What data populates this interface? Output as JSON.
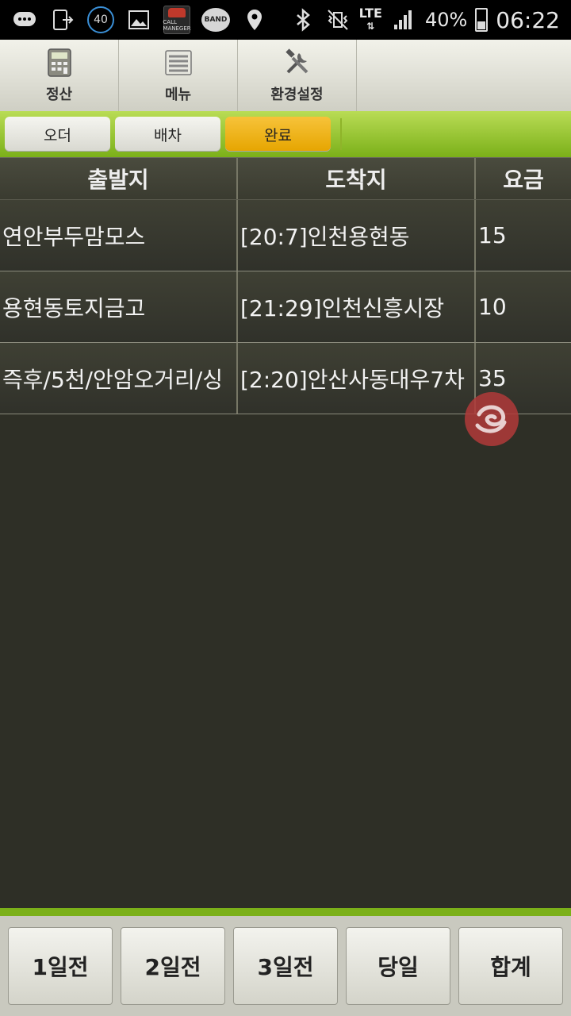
{
  "status_bar": {
    "badge_number": "40",
    "call_app_label": "CALL MANEGER",
    "band_label": "BAND",
    "network": "LTE",
    "battery": "40%",
    "time": "06:22"
  },
  "top_menu": [
    {
      "label": "정산",
      "icon": "calculator-icon"
    },
    {
      "label": "메뉴",
      "icon": "list-icon"
    },
    {
      "label": "환경설정",
      "icon": "tools-icon"
    }
  ],
  "tabs": [
    {
      "label": "오더",
      "active": false
    },
    {
      "label": "배차",
      "active": false
    },
    {
      "label": "완료",
      "active": true
    }
  ],
  "table": {
    "headers": [
      "출발지",
      "도착지",
      "요금"
    ],
    "rows": [
      {
        "origin": "연안부두맘모스",
        "destination": "[20:7]인천용현동",
        "fare": "15"
      },
      {
        "origin": "용현동토지금고",
        "destination": "[21:29]인천신흥시장",
        "fare": "10"
      },
      {
        "origin": "즉후/5천/안암오거리/싱",
        "destination": "[2:20]안산사동대우7차",
        "fare": "35"
      }
    ]
  },
  "bottom_buttons": [
    "1일전",
    "2일전",
    "3일전",
    "당일",
    "합계"
  ],
  "colors": {
    "accent_green": "#7bb019",
    "active_tab": "#e6a500",
    "background": "#2e2f26"
  }
}
